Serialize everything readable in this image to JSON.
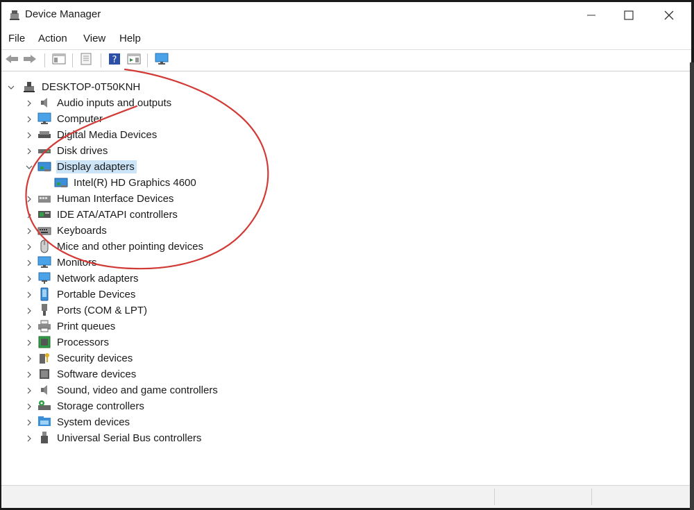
{
  "window": {
    "title": "Device Manager",
    "app_icon": "device-manager-icon"
  },
  "title_buttons": [
    {
      "name": "minimize-button",
      "icon": "minimize-icon"
    },
    {
      "name": "maximize-button",
      "icon": "maximize-icon"
    },
    {
      "name": "close-button",
      "icon": "close-icon"
    }
  ],
  "menu": {
    "file": "File",
    "action": "Action",
    "view": "View",
    "help": "Help"
  },
  "toolbar": {
    "buttons": [
      "back-arrow-icon",
      "forward-arrow-icon",
      "show-hide-console-tree-icon",
      "properties-icon",
      "help-icon",
      "show-action-pane-icon",
      "monitor-icon"
    ]
  },
  "tree": {
    "root": {
      "label": "DESKTOP-0T50KNH",
      "expanded": true,
      "icon": "computer-tower-icon"
    },
    "categories": [
      {
        "label": "Audio inputs and outputs",
        "icon": "speaker-icon",
        "expanded": false
      },
      {
        "label": "Computer",
        "icon": "computer-monitor-icon",
        "expanded": false
      },
      {
        "label": "Digital Media Devices",
        "icon": "media-device-icon",
        "expanded": false
      },
      {
        "label": "Disk drives",
        "icon": "disk-drive-icon",
        "expanded": false
      },
      {
        "label": "Display adapters",
        "icon": "display-adapter-icon",
        "expanded": true,
        "selected": true,
        "children": [
          {
            "label": "Intel(R) HD Graphics 4600",
            "icon": "display-adapter-icon"
          }
        ]
      },
      {
        "label": "Human Interface Devices",
        "icon": "hid-icon",
        "expanded": false
      },
      {
        "label": "IDE ATA/ATAPI controllers",
        "icon": "ide-controller-icon",
        "expanded": false
      },
      {
        "label": "Keyboards",
        "icon": "keyboard-icon",
        "expanded": false
      },
      {
        "label": "Mice and other pointing devices",
        "icon": "mouse-icon",
        "expanded": false
      },
      {
        "label": "Monitors",
        "icon": "monitor-icon",
        "expanded": false
      },
      {
        "label": "Network adapters",
        "icon": "network-adapter-icon",
        "expanded": false
      },
      {
        "label": "Portable Devices",
        "icon": "portable-device-icon",
        "expanded": false
      },
      {
        "label": "Ports (COM & LPT)",
        "icon": "port-icon",
        "expanded": false
      },
      {
        "label": "Print queues",
        "icon": "printer-icon",
        "expanded": false
      },
      {
        "label": "Processors",
        "icon": "processor-icon",
        "expanded": false
      },
      {
        "label": "Security devices",
        "icon": "security-key-icon",
        "expanded": false
      },
      {
        "label": "Software devices",
        "icon": "software-device-icon",
        "expanded": false
      },
      {
        "label": "Sound, video and game controllers",
        "icon": "speaker-icon",
        "expanded": false
      },
      {
        "label": "Storage controllers",
        "icon": "storage-controller-icon",
        "expanded": false
      },
      {
        "label": "System devices",
        "icon": "system-folder-icon",
        "expanded": false
      },
      {
        "label": "Universal Serial Bus controllers",
        "icon": "usb-icon",
        "expanded": false
      }
    ]
  },
  "annotation": {
    "color": "#d23a36",
    "shape": "hand-drawn-circle"
  },
  "colors": {
    "selection": "#cce4f7",
    "icon_blue": "#3a8fd8"
  }
}
